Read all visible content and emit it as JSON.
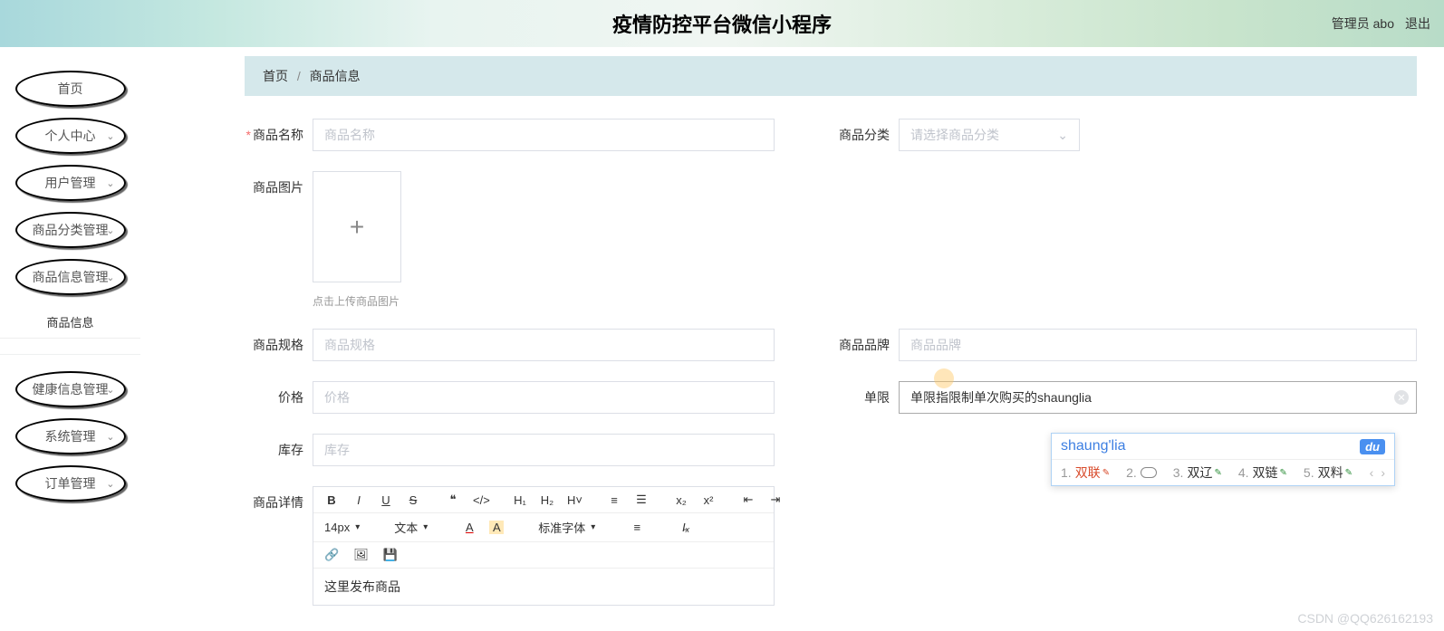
{
  "header": {
    "app_title": "疫情防控平台微信小程序",
    "user_label": "管理员 abo",
    "logout_label": "退出"
  },
  "sidebar": {
    "items": [
      {
        "label": "首页",
        "expandable": false
      },
      {
        "label": "个人中心",
        "expandable": true
      },
      {
        "label": "用户管理",
        "expandable": true
      },
      {
        "label": "商品分类管理",
        "expandable": true
      },
      {
        "label": "商品信息管理",
        "expandable": true
      },
      {
        "label": "健康信息管理",
        "expandable": true
      },
      {
        "label": "系统管理",
        "expandable": true
      },
      {
        "label": "订单管理",
        "expandable": true
      }
    ],
    "sub_item": "商品信息"
  },
  "breadcrumb": {
    "home": "首页",
    "current": "商品信息"
  },
  "form": {
    "name_label": "商品名称",
    "name_placeholder": "商品名称",
    "category_label": "商品分类",
    "category_placeholder": "请选择商品分类",
    "image_label": "商品图片",
    "image_hint": "点击上传商品图片",
    "spec_label": "商品规格",
    "spec_placeholder": "商品规格",
    "brand_label": "商品品牌",
    "brand_placeholder": "商品品牌",
    "price_label": "价格",
    "price_placeholder": "价格",
    "limit_label": "单限",
    "limit_value": "单限指限制单次购买的shaunglia",
    "stock_label": "库存",
    "stock_placeholder": "库存",
    "detail_label": "商品详情",
    "detail_content": "这里发布商品"
  },
  "editor_toolbar": {
    "font_size": "14px",
    "text_label": "文本",
    "font_family": "标准字体"
  },
  "ime": {
    "composition": "shaung'lia",
    "logo": "du",
    "candidates": [
      {
        "num": "1.",
        "text": "双联"
      },
      {
        "num": "2.",
        "text": ""
      },
      {
        "num": "3.",
        "text": "双辽"
      },
      {
        "num": "4.",
        "text": "双链"
      },
      {
        "num": "5.",
        "text": "双料"
      }
    ]
  },
  "watermark": "CSDN @QQ626162193"
}
